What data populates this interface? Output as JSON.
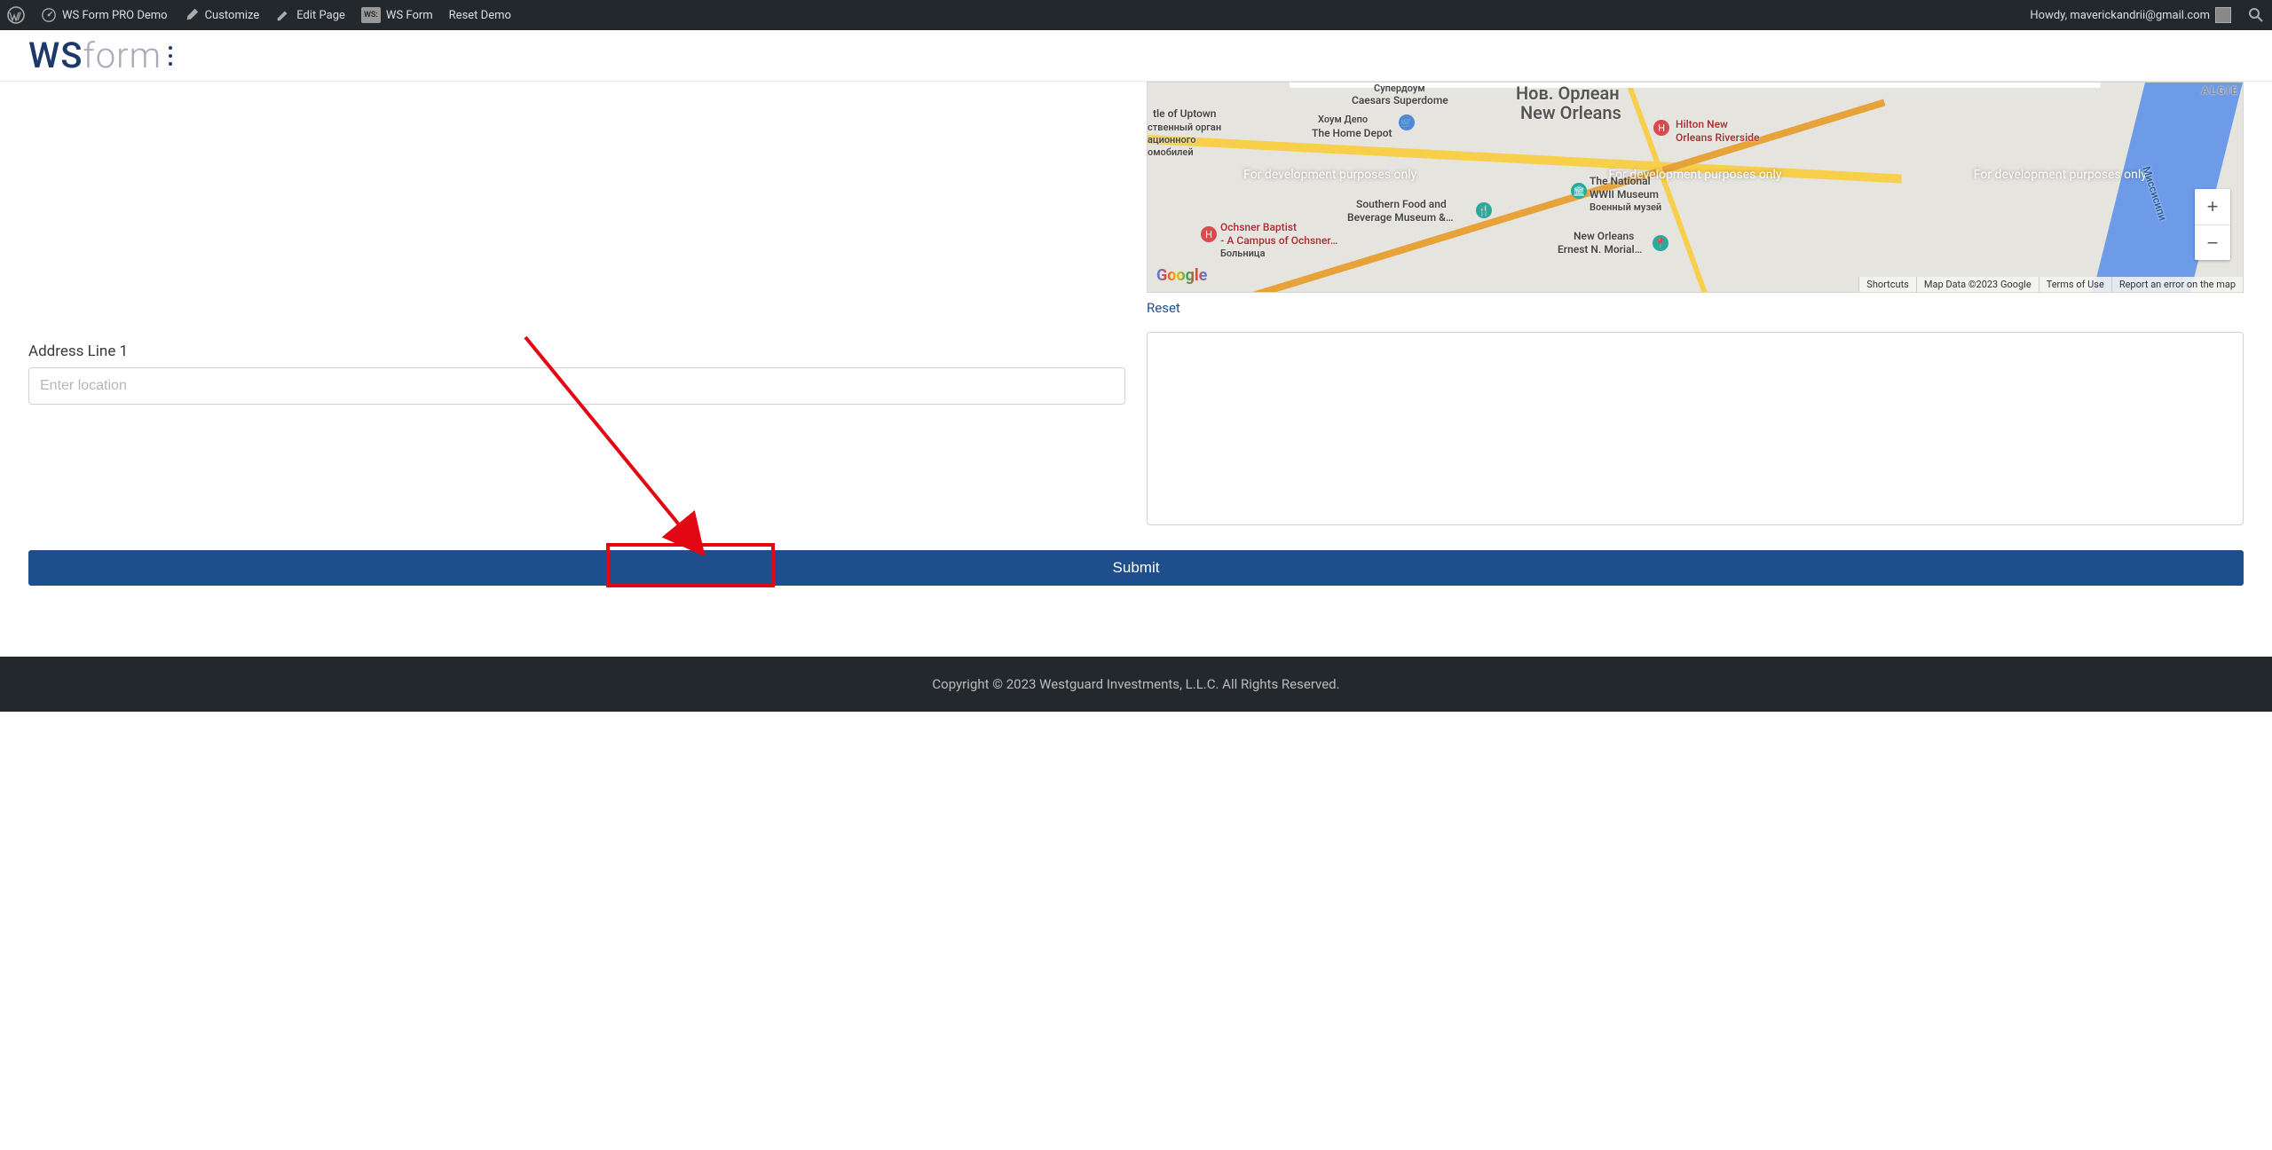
{
  "adminbar": {
    "site_name": "WS Form PRO Demo",
    "customize": "Customize",
    "edit_page": "Edit Page",
    "ws_form": "WS Form",
    "ws_form_badge": "WS:",
    "reset_demo": "Reset Demo",
    "howdy": "Howdy, maverickandrii@gmail.com"
  },
  "map": {
    "title_city": "New Orleans",
    "title_city_ru": "Нов. Орлеан",
    "watermark": "For development purposes only",
    "labels": {
      "uptown": "tle of Uptown",
      "uptown_ru_1": "ственный орган",
      "uptown_ru_2": "ационного",
      "uptown_ru_3": "омобилей",
      "superdome_ru": "Супердоум",
      "superdome": "Caesars Superdome",
      "home_depot_ru": "Хоум Депо",
      "home_depot": "The Home Depot",
      "ochsner_1": "Ochsner Baptist",
      "ochsner_2": "- A Campus of Ochsner…",
      "ochsner_ru": "Больница",
      "southern_1": "Southern Food and",
      "southern_2": "Beverage Museum &…",
      "wwii_1": "The National",
      "wwii_2": "WWII Museum",
      "wwii_ru": "Военный музей",
      "morial_1": "New Orleans",
      "morial_2": "Ernest N. Morial…",
      "hilton_1": "Hilton New",
      "hilton_2": "Orleans Riverside",
      "algie": "ALGIE",
      "miss_ru": "Миссисипи"
    },
    "attrib": {
      "shortcuts": "Shortcuts",
      "mapdata": "Map Data ©2023 Google",
      "terms": "Terms of Use",
      "report": "Report an error on the map"
    },
    "google": "Google",
    "zoom_in": "+",
    "zoom_out": "−"
  },
  "form": {
    "reset": "Reset",
    "address_label": "Address Line 1",
    "address_placeholder": "Enter location",
    "submit": "Submit"
  },
  "footer": {
    "copyright": "Copyright © 2023 Westguard Investments, L.L.C. All Rights Reserved."
  }
}
